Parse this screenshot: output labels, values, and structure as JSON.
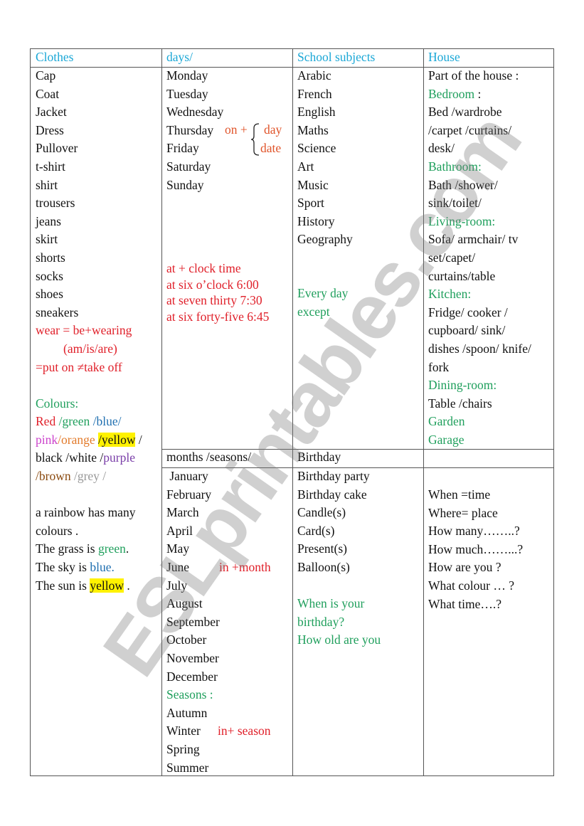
{
  "watermark": "ESLprintables.com",
  "headers": {
    "clothes": "Clothes",
    "days": "days/",
    "school": "School subjects",
    "house": "House"
  },
  "clothes": {
    "items": [
      "Cap",
      "Coat",
      "Jacket",
      "Dress",
      "Pullover",
      "t-shirt",
      "shirt",
      "trousers",
      "jeans",
      "skirt",
      "shorts",
      "socks",
      "shoes",
      "sneakers"
    ],
    "wear_rule": [
      "wear = be+wearing",
      "(am/is/are)",
      "=put on ≠take off"
    ],
    "colours_title": "Colours:",
    "colours_line1": {
      "red": "Red",
      "green": "/green",
      "blue": "/blue/"
    },
    "colours_line2": {
      "pink": "pink",
      "orange": "/orange",
      "yellow": "/yellow",
      "sep": " /"
    },
    "colours_line3": {
      "black": "black  /white /",
      "purple": "purple"
    },
    "colours_line4": {
      "brown": "/brown",
      "grey": "/grey /"
    },
    "rainbow": [
      "a rainbow  has many",
      "colours ."
    ],
    "grass": {
      "prefix": "The grass is ",
      "colour": "green",
      "suffix": "."
    },
    "sky": {
      "prefix": "The sky is ",
      "colour": "blue",
      "suffix": "."
    },
    "sun": {
      "prefix": "The sun is ",
      "colour": "yellow",
      "suffix": " ."
    }
  },
  "days": {
    "items": [
      "Monday",
      "Tuesday",
      "Wednesday",
      "Thursday",
      "Friday",
      "Saturday",
      "Sunday"
    ],
    "on_rule": {
      "prefix": "on +",
      "options": [
        "day",
        "date"
      ]
    },
    "at_rules": [
      "at + clock time",
      "at six o’clock  6:00",
      "at seven thirty 7:30",
      "at six forty-five  6:45"
    ]
  },
  "school": {
    "items": [
      "Arabic",
      "French",
      "English",
      "Maths",
      "Science",
      "Art",
      "Music",
      "Sport",
      "History",
      "Geography"
    ],
    "note": [
      "Every day",
      "except"
    ]
  },
  "house": {
    "intro": "Part of the house :",
    "sections": [
      {
        "title": "Bedroom",
        "suffix": " :",
        "lines": [
          "Bed /wardrobe",
          "/carpet /curtains/",
          "desk/"
        ]
      },
      {
        "title": "Bathroom:",
        "suffix": "",
        "lines": [
          "Bath /shower/",
          "sink/toilet/"
        ]
      },
      {
        "title": "Living-room:",
        "suffix": "",
        "lines": [
          "Sofa/ armchair/ tv",
          "set/capet/",
          "curtains/table"
        ]
      },
      {
        "title": "Kitchen:",
        "suffix": "",
        "lines": [
          "Fridge/ cooker /",
          "cupboard/ sink/",
          "dishes /spoon/ knife/",
          "fork"
        ]
      },
      {
        "title": "Dining-room:",
        "suffix": "",
        "lines": [
          "Table /chairs"
        ]
      }
    ],
    "extra": [
      "Garden",
      "Garage"
    ]
  },
  "headers2": {
    "months": "months /seasons/",
    "birthday": "Birthday",
    "questions": ""
  },
  "months": {
    "items": [
      " January",
      "February",
      "March",
      "April",
      "May",
      "June",
      "July",
      "August",
      "September",
      "October",
      "November",
      "December"
    ],
    "in_month": "in +month",
    "seasons_title": "Seasons :",
    "seasons": [
      "Autumn",
      "Winter",
      "Spring",
      "Summer"
    ],
    "in_season": "in+ season"
  },
  "birthday": {
    "items": [
      "Birthday party",
      "Birthday cake",
      "Candle(s)",
      "Card(s)",
      "Present(s)",
      "Balloon(s)"
    ],
    "questions": [
      "When is your",
      "birthday?",
      "How old are you"
    ]
  },
  "questions": {
    "items": [
      "When =time",
      "Where= place",
      "How many……..?",
      "How much……...?",
      "How are you ?",
      "What colour …  ?",
      "What time….?"
    ]
  }
}
